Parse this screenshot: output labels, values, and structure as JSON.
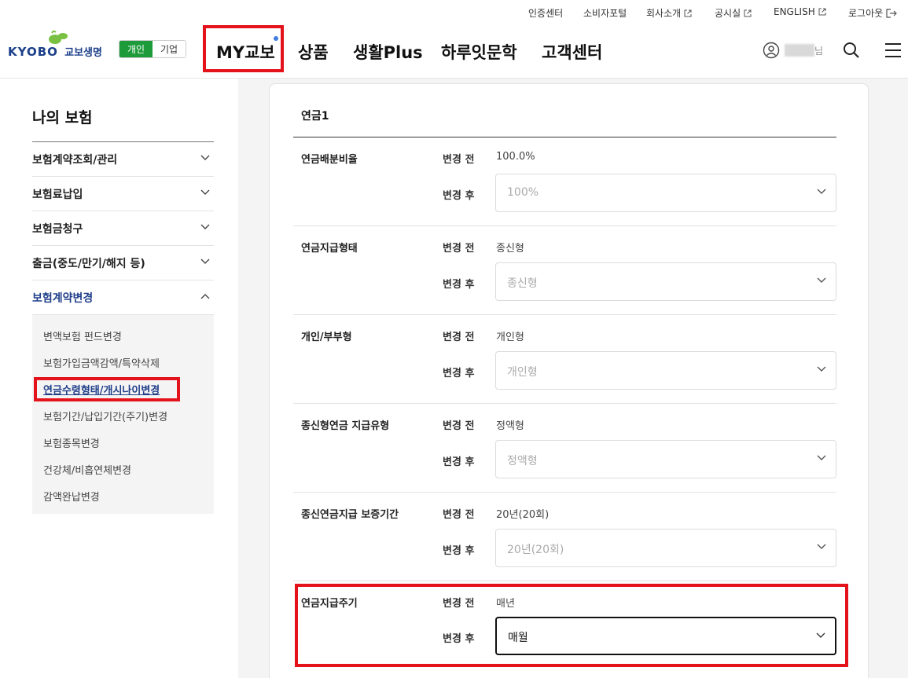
{
  "util": {
    "items": [
      "인증센터",
      "소비자포털",
      "회사소개",
      "공시실",
      "ENGLISH",
      "로그아웃"
    ]
  },
  "brand": {
    "name": "KYOBO",
    "name_ko": "교보생명",
    "green": "#1d9b3a",
    "navy": "#1b3f8a",
    "highlight": "#e3121b"
  },
  "segment": {
    "personal": "개인",
    "corporate": "기업"
  },
  "gnb": {
    "items": [
      "MY교보",
      "상품",
      "생활Plus",
      "하루잇문학",
      "고객센터"
    ]
  },
  "user": {
    "suffix": "님"
  },
  "lnb": {
    "title": "나의 보험",
    "menus": [
      "보험계약조회/관리",
      "보험료납입",
      "보험금청구",
      "출금(중도/만기/해지 등)",
      "보험계약변경"
    ],
    "sub": [
      "변액보험 펀드변경",
      "보험가입금액감액/특약삭제",
      "연금수령형태/개시나이변경",
      "보험기간/납입기간(주기)변경",
      "보험종목변경",
      "건강체/비흡연체변경",
      "감액완납변경"
    ]
  },
  "form": {
    "title": "연금1",
    "before_tag": "변경 전",
    "after_tag": "변경 후",
    "fields": [
      {
        "label": "연금배분비율",
        "before": "100.0%",
        "after": "100%"
      },
      {
        "label": "연금지급형태",
        "before": "종신형",
        "after": "종신형"
      },
      {
        "label": "개인/부부형",
        "before": "개인형",
        "after": "개인형"
      },
      {
        "label": "종신형연금 지급유형",
        "before": "정액형",
        "after": "정액형"
      },
      {
        "label": "종신연금지급 보증기간",
        "before": "20년(20회)",
        "after": "20년(20회)"
      },
      {
        "label": "연금지급주기",
        "before": "매년",
        "after": "매월"
      }
    ]
  }
}
